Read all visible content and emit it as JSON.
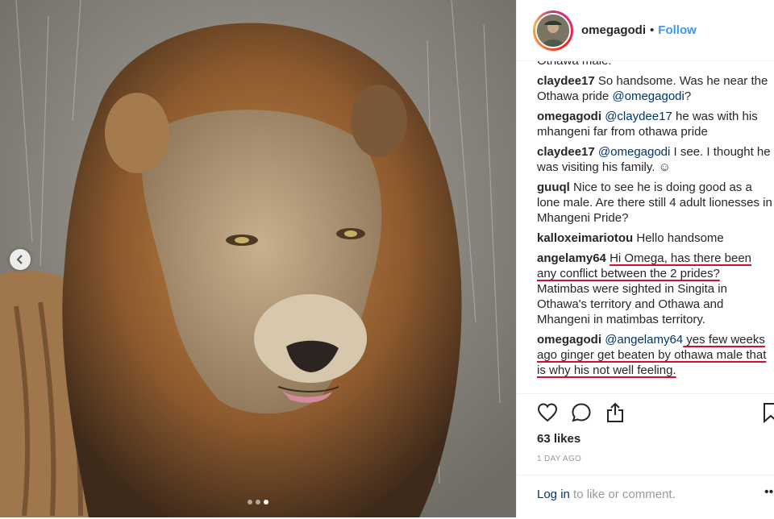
{
  "post": {
    "photo_alt": "Male lion with tongue out",
    "carousel": {
      "total": 3,
      "active": 3
    }
  },
  "header": {
    "username": "omegagodi",
    "separator": "•",
    "follow_label": "Follow"
  },
  "comments": [
    {
      "user": "",
      "parts": [
        {
          "t": "Othawa male.",
          "type": "text"
        }
      ]
    },
    {
      "user": "claydee17",
      "parts": [
        {
          "t": "So handsome. Was he near the Othawa pride ",
          "type": "text"
        },
        {
          "t": "@omegagodi",
          "type": "mention"
        },
        {
          "t": "?",
          "type": "text"
        }
      ]
    },
    {
      "user": "omegagodi",
      "parts": [
        {
          "t": "@claydee17",
          "type": "mention"
        },
        {
          "t": " he was with his mhangeni far from othawa pride",
          "type": "text"
        }
      ]
    },
    {
      "user": "claydee17",
      "parts": [
        {
          "t": "@omegagodi",
          "type": "mention"
        },
        {
          "t": " I see. I thought he was visiting his family. ☺",
          "type": "text"
        }
      ]
    },
    {
      "user": "guuql",
      "parts": [
        {
          "t": "Nice to see he is doing good as a lone male. Are there still 4 adult lionesses in Mhangeni Pride?",
          "type": "text"
        }
      ]
    },
    {
      "user": "kalloxeimariotou",
      "parts": [
        {
          "t": "Hello handsome",
          "type": "text"
        }
      ]
    },
    {
      "user": "angelamy64",
      "parts": [
        {
          "t": "Hi Omega, has there been any conflict between the 2 prides?",
          "type": "marked"
        },
        {
          "t": " Matimbas were sighted in Singita in Othawa's territory and Othawa and Mhangeni in matimbas territory.",
          "type": "text"
        }
      ]
    },
    {
      "user": "omegagodi",
      "parts": [
        {
          "t": "@angelamy64",
          "type": "mention"
        },
        {
          "t": " yes few weeks ago ginger get beaten by othawa male that is why his not well feeling.",
          "type": "marked"
        }
      ]
    }
  ],
  "actions": {
    "likes": "63 likes",
    "date": "1 DAY AGO",
    "login_link": "Log in",
    "login_rest": " to like or comment.",
    "more": "•••"
  },
  "colors": {
    "follow": "#3897f0",
    "mention": "#003569",
    "underline": "#d3102b"
  }
}
